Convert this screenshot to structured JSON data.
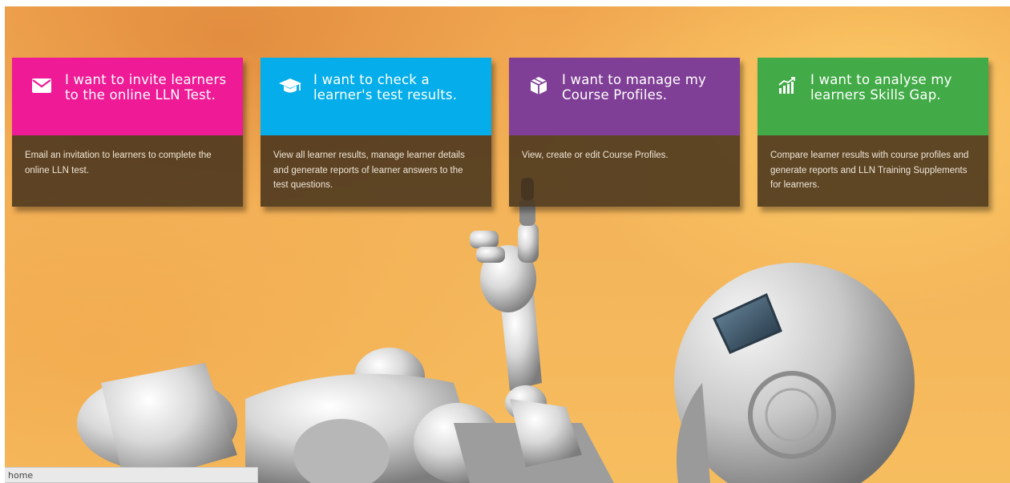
{
  "cards": [
    {
      "icon": "envelope-icon",
      "title_line1": "I want to invite learners",
      "title_line2": "to the online LLN Test.",
      "description": "Email an invitation to learners to complete the online LLN test.",
      "color": "#ee1a96"
    },
    {
      "icon": "graduation-cap-icon",
      "title_line1": "I want to check a",
      "title_line2": "learner's test results.",
      "description": "View all learner results, manage learner details and generate reports of learner answers to the test questions.",
      "color": "#05aeea"
    },
    {
      "icon": "cubes-icon",
      "title_line1": "I want to manage my",
      "title_line2": "Course Profiles.",
      "description": "View, create or edit Course Profiles.",
      "color": "#803f96"
    },
    {
      "icon": "bar-chart-icon",
      "title_line1": "I want to analyse my",
      "title_line2": "learners Skills Gap.",
      "description": "Compare learner results with course profiles and generate reports and LLN Training Supplements for learners.",
      "color": "#42ab47"
    }
  ],
  "background": {
    "image": "lying-robot-illustration"
  },
  "status_bar": {
    "text": "home"
  }
}
